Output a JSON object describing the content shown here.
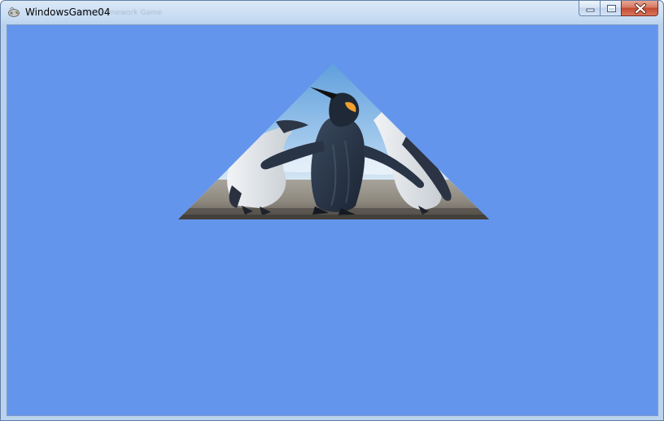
{
  "window": {
    "title": "WindowsGame04",
    "title_ghost": "Hello, Framework Game"
  },
  "caption_buttons": {
    "minimize_icon": "minimize-icon",
    "maximize_icon": "maximize-icon",
    "close_icon": "close-icon"
  },
  "client": {
    "background_color": "#6495ed",
    "sprite": "penguins-triangle-sprite"
  },
  "colors": {
    "cornflower_blue": "#6495ed",
    "close_red": "#c24a30"
  }
}
